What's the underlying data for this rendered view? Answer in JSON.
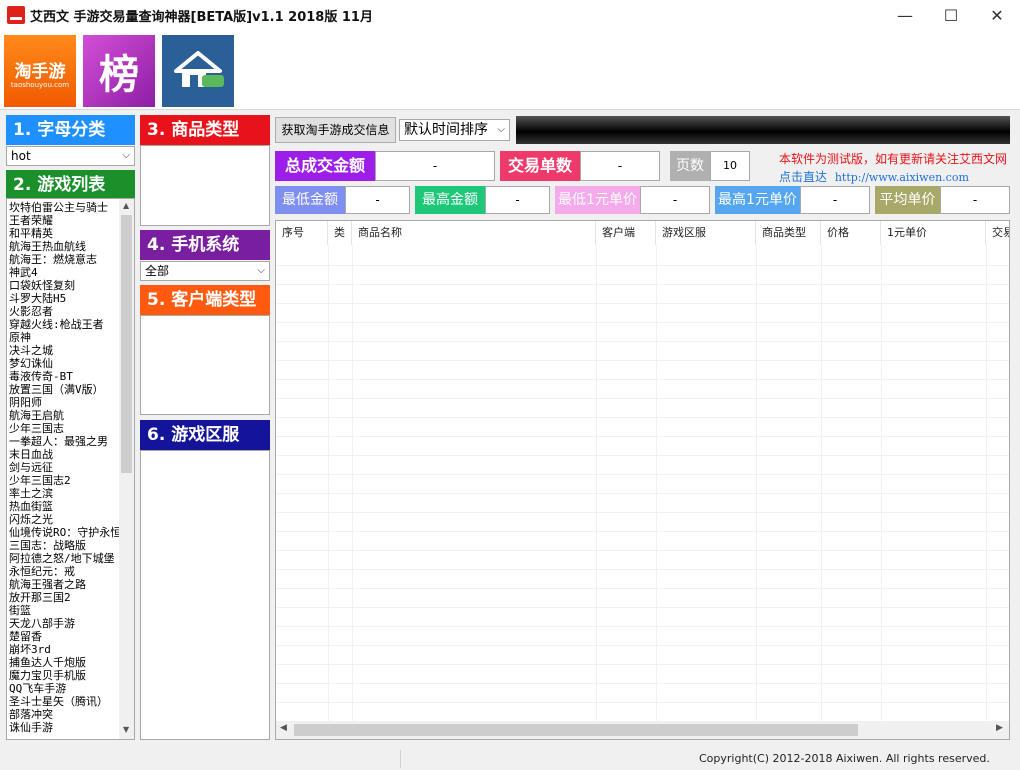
{
  "window": {
    "title": "艾西文 手游交易量查询神器[BETA版]v1.1 2018版 11月",
    "controls": {
      "minimize": "—",
      "maximize": "☐",
      "close": "✕"
    }
  },
  "banner": {
    "taoshou_big": "淘手游",
    "taoshou_small": "taoshouyou.com",
    "bang": "榜"
  },
  "sections": {
    "letter": "1. 字母分类",
    "games": "2. 游戏列表",
    "goods_type": "3. 商品类型",
    "os": "4. 手机系统",
    "client": "5. 客户端类型",
    "server": "6. 游戏区服"
  },
  "letter_select": "hot",
  "os_select": "全部",
  "games": [
    "坎特伯雷公主与骑士",
    "王者荣耀",
    "和平精英",
    "航海王热血航线",
    "航海王：燃烧意志",
    "神武4",
    "口袋妖怪复刻",
    "斗罗大陆H5",
    "火影忍者",
    "穿越火线:枪战王者",
    "原神",
    "决斗之城",
    "梦幻诛仙",
    "毒液传奇-BT",
    "放置三国（满V版）",
    "阴阳师",
    "航海王启航",
    "少年三国志",
    "一拳超人：最强之男",
    "末日血战",
    "剑与远征",
    "少年三国志2",
    "率土之滨",
    "热血街篮",
    "闪烁之光",
    "仙境传说RO：守护永恒",
    "三国志：战略版",
    "阿拉德之怒/地下城堡",
    "永恒纪元：戒",
    "航海王强者之路",
    "放开那三国2",
    "街篮",
    "天龙八部手游",
    "楚留香",
    "崩坏3rd",
    "捕鱼达人千炮版",
    "魔力宝贝手机版",
    "QQ飞车手游",
    "圣斗士星矢（腾讯）",
    "部落冲突",
    "诛仙手游"
  ],
  "toolbar": {
    "fetch_button": "获取淘手游成交信息",
    "sort_select": "默认时间排序"
  },
  "stats": {
    "total_amount_label": "总成交金额",
    "total_amount_value": "-",
    "order_count_label": "交易单数",
    "order_count_value": "-",
    "pages_label": "页数",
    "pages_value": "10",
    "min_amount_label": "最低金额",
    "min_amount_value": "-",
    "max_amount_label": "最高金额",
    "max_amount_value": "-",
    "min_unit_label": "最低1元单价",
    "min_unit_value": "-",
    "max_unit_label": "最高1元单价",
    "max_unit_value": "-",
    "avg_unit_label": "平均单价",
    "avg_unit_value": "-"
  },
  "notice": {
    "line1": "本软件为测试版，如有更新请关注艾西文网",
    "line2_prefix": "点击直达",
    "url": "http://www.aixiwen.com"
  },
  "table": {
    "columns": [
      "序号",
      "类",
      "商品名称",
      "客户端",
      "游戏区服",
      "商品类型",
      "价格",
      "1元单价",
      "交易"
    ]
  },
  "footer": {
    "copyright": "Copyright(C) 2012-2018 Aixiwen. All rights reserved."
  },
  "colors": {
    "blue": "#1e90ff",
    "green": "#1a8f2a",
    "red": "#e8131a",
    "purple": "#7a1ea0",
    "orange": "#ff5a10",
    "navy": "#14149a",
    "total_purple": "#9c1ee8",
    "order_pink": "#ee3a6a",
    "gray": "#b0b0b0",
    "min_blue": "#7f8fef",
    "max_green": "#1ec878",
    "min_unit_pink": "#f5aaec",
    "max_unit_blue": "#55a6f0",
    "avg_olive": "#a8a868"
  }
}
